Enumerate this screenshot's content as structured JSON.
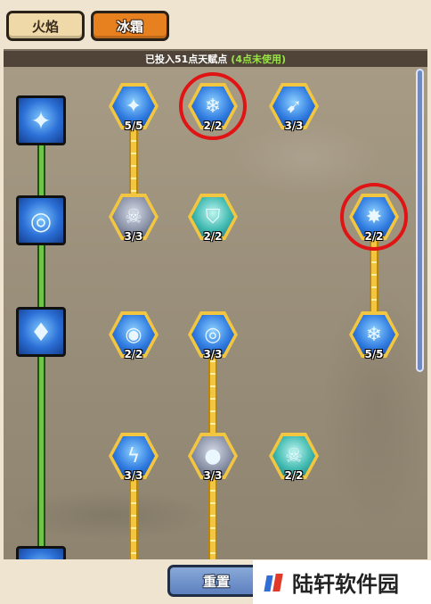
{
  "tabs": [
    {
      "label": "火焰",
      "active": false
    },
    {
      "label": "冰霜",
      "active": true
    }
  ],
  "points": {
    "invested_text": "已投入51点天赋点",
    "unused_text": "(4点未使用)"
  },
  "tiers": [
    {
      "icon": "frost-staff-icon"
    },
    {
      "icon": "frost-orb-icon"
    },
    {
      "icon": "ice-crystal-icon"
    },
    {
      "icon": "frost-tier4-icon"
    }
  ],
  "skills": {
    "r1": [
      {
        "level": "5/5",
        "icon": "frost-staff-icon",
        "glyph": "✦"
      },
      {
        "level": "2/2",
        "icon": "ice-shards-icon",
        "glyph": "❄",
        "highlighted": true
      },
      {
        "level": "3/3",
        "icon": "ice-bolt-icon",
        "glyph": "➹"
      }
    ],
    "r2": [
      {
        "level": "3/3",
        "icon": "skull-icon",
        "glyph": "☠"
      },
      {
        "level": "2/2",
        "icon": "ice-armor-icon",
        "glyph": "⛉"
      },
      {
        "level": "2/2",
        "icon": "ice-burst-icon",
        "glyph": "✸",
        "highlighted": true
      }
    ],
    "r3": [
      {
        "level": "2/2",
        "icon": "frost-rune-icon",
        "glyph": "◉"
      },
      {
        "level": "3/3",
        "icon": "blizzard-icon",
        "glyph": "◎"
      },
      {
        "level": "5/5",
        "icon": "snowflake-icon",
        "glyph": "❄"
      }
    ],
    "r4": [
      {
        "level": "3/3",
        "icon": "frost-lightning-icon",
        "glyph": "ϟ"
      },
      {
        "level": "3/3",
        "icon": "ice-rock-icon",
        "glyph": "●"
      },
      {
        "level": "2/2",
        "icon": "ice-skull-icon",
        "glyph": "☠"
      }
    ]
  },
  "buttons": {
    "reset": "重置"
  },
  "watermark": "陆轩软件园",
  "colors": {
    "active_tab": "#e7801f",
    "connector": "#f4c53f",
    "tier_track": "#6fc449",
    "highlight_ring": "#e01414",
    "unused_points": "#9be34a"
  }
}
